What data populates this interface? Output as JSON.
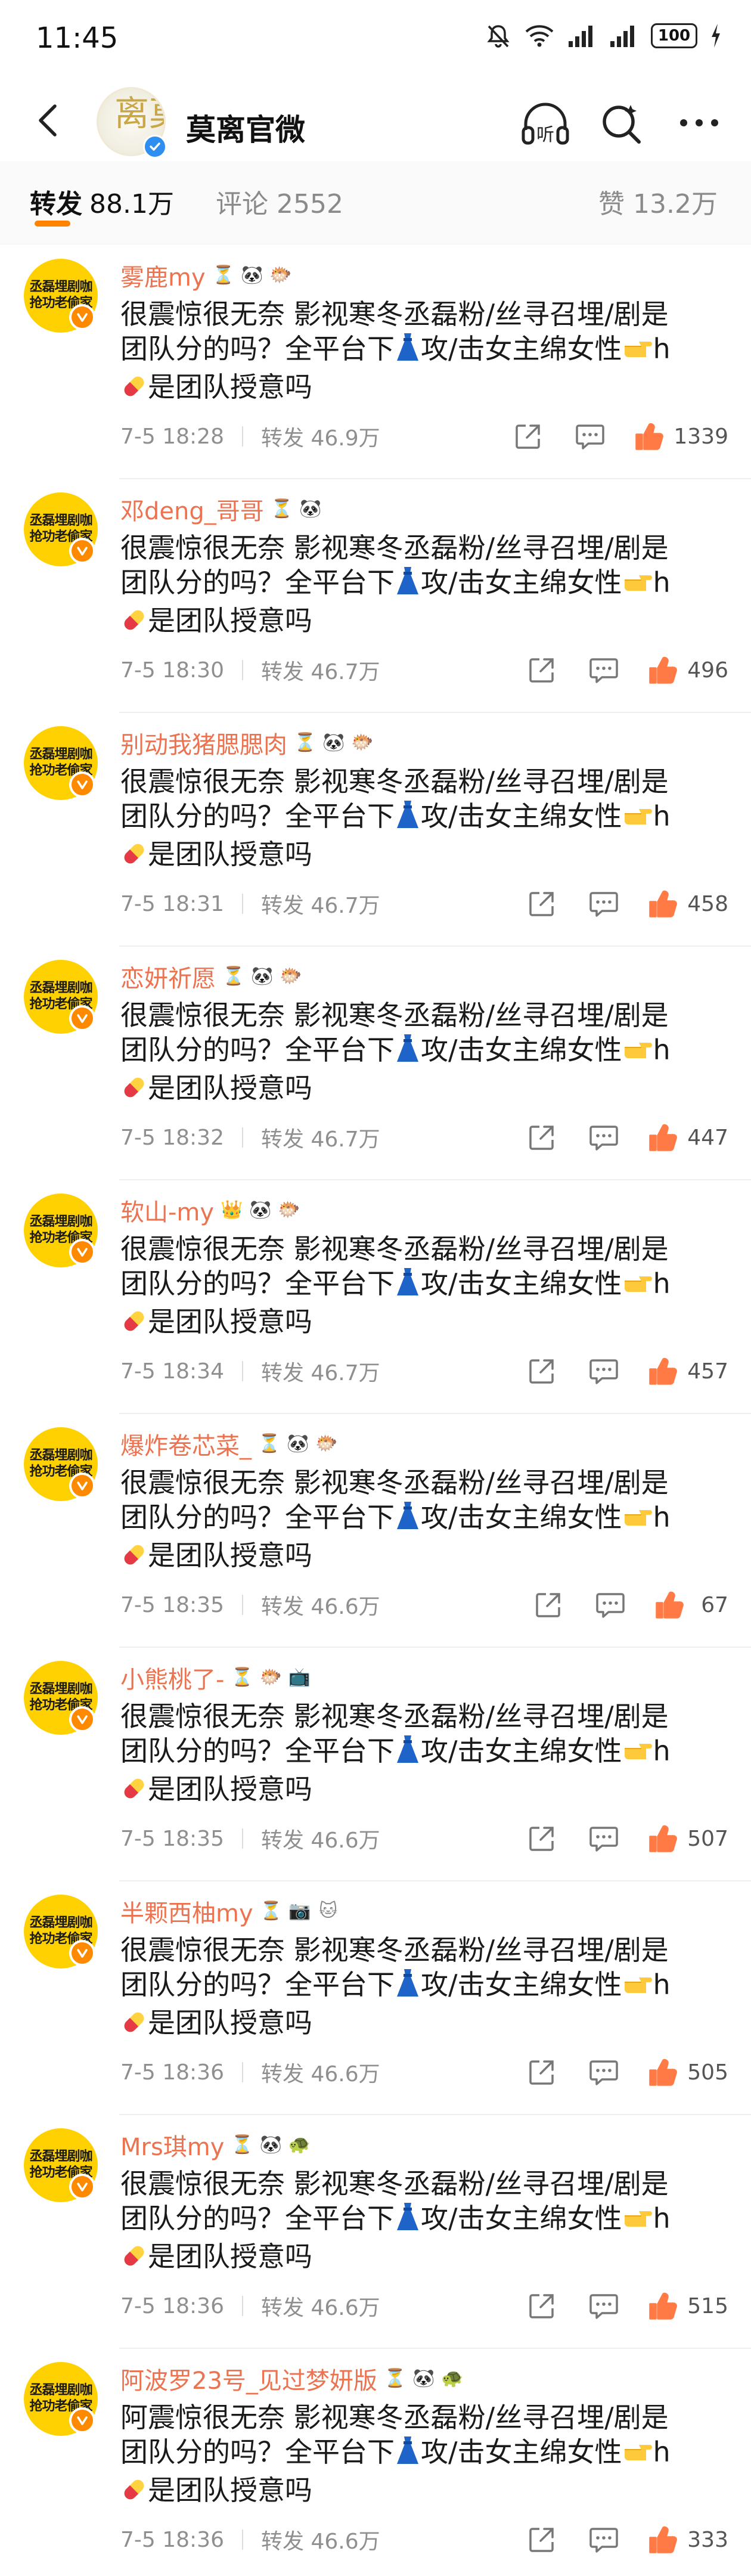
{
  "status_bar": {
    "time": "11:45",
    "battery": "100"
  },
  "header": {
    "title": "莫离官微",
    "avatar_text": "莫离",
    "listen_label": "听"
  },
  "tabs": {
    "repost_label": "转发",
    "repost_count": "88.1万",
    "comments": "评论 2552",
    "likes": "赞 13.2万"
  },
  "post_text": {
    "line1": "很震惊很无奈 影视寒冬丞磊粉/丝寻召埋/剧是",
    "line2a": "团队分的吗？全平台下",
    "line2b": "攻/击女主绵女性",
    "line2c": "h",
    "line3": "是团队授意吗",
    "line1_alt": "阿震惊很无奈 影视寒冬丞磊粉/丝寻召埋/剧是"
  },
  "avatar_text": {
    "line1": "丞磊埋剧咖",
    "line2": "抢功老偷家"
  },
  "labels": {
    "repost_prefix": "转发"
  },
  "colors": {
    "accent": "#ff8200",
    "username": "#eb7350",
    "verified": "#2e8ff0",
    "like_active": "#ff7a45"
  },
  "items": [
    {
      "username": "雾鹿my",
      "icons": [
        "hourglass-icon",
        "panda-icon",
        "pufferfish-icon"
      ],
      "time": "7-5 18:28",
      "reposts": "46.9万",
      "likes": "1339",
      "liked": true,
      "first_line": "line1"
    },
    {
      "username": "邓deng_哥哥",
      "icons": [
        "hourglass-icon",
        "panda-icon"
      ],
      "time": "7-5 18:30",
      "reposts": "46.7万",
      "likes": "496",
      "liked": false,
      "first_line": "line1"
    },
    {
      "username": "别动我猪腮腮肉",
      "icons": [
        "hourglass-icon",
        "panda-icon",
        "pufferfish-icon"
      ],
      "time": "7-5 18:31",
      "reposts": "46.7万",
      "likes": "458",
      "liked": false,
      "first_line": "line1"
    },
    {
      "username": "恋妍祈愿",
      "icons": [
        "hourglass-icon",
        "panda-icon",
        "pufferfish-icon"
      ],
      "time": "7-5 18:32",
      "reposts": "46.7万",
      "likes": "447",
      "liked": false,
      "first_line": "line1"
    },
    {
      "username": "软山-my",
      "icons": [
        "crown-icon",
        "panda-icon",
        "pufferfish-icon"
      ],
      "time": "7-5 18:34",
      "reposts": "46.7万",
      "likes": "457",
      "liked": false,
      "first_line": "line1"
    },
    {
      "username": "爆炸卷芯菜_",
      "icons": [
        "hourglass-icon",
        "panda-icon",
        "pufferfish-icon"
      ],
      "time": "7-5 18:35",
      "reposts": "46.6万",
      "likes": "67",
      "liked": false,
      "first_line": "line1"
    },
    {
      "username": "小熊桃了-",
      "icons": [
        "hourglass-icon",
        "pufferfish-icon",
        "tv-icon"
      ],
      "time": "7-5 18:35",
      "reposts": "46.6万",
      "likes": "507",
      "liked": false,
      "first_line": "line1"
    },
    {
      "username": "半颗西柚my",
      "icons": [
        "hourglass-icon",
        "camera-icon",
        "cat-icon"
      ],
      "time": "7-5 18:36",
      "reposts": "46.6万",
      "likes": "505",
      "liked": false,
      "first_line": "line1"
    },
    {
      "username": "Mrs琪my",
      "icons": [
        "hourglass-icon",
        "panda-icon",
        "turtle-icon"
      ],
      "time": "7-5 18:36",
      "reposts": "46.6万",
      "likes": "515",
      "liked": false,
      "first_line": "line1"
    },
    {
      "username": "阿波罗23号_见过梦妍版",
      "icons": [
        "hourglass-icon",
        "panda-icon",
        "turtle-icon"
      ],
      "time": "7-5 18:36",
      "reposts": "46.6万",
      "likes": "333",
      "liked": false,
      "first_line": "line1_alt"
    }
  ]
}
